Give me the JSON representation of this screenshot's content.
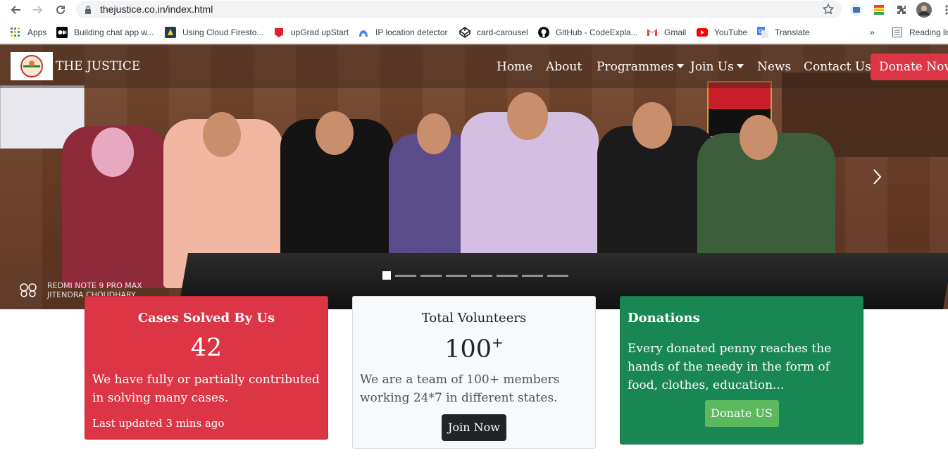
{
  "browser": {
    "url": "thejustice.co.in/index.html",
    "bookmarks": [
      {
        "label": "Apps",
        "icon": "apps-grid-icon"
      },
      {
        "label": "Building chat app w...",
        "icon": "medium-icon"
      },
      {
        "label": "Using Cloud Firesto...",
        "icon": "firestore-icon"
      },
      {
        "label": "upGrad upStart",
        "icon": "upgrad-icon"
      },
      {
        "label": "IP location detector",
        "icon": "ip-icon"
      },
      {
        "label": "card-carousel",
        "icon": "codepen-icon"
      },
      {
        "label": "GitHub - CodeExpla...",
        "icon": "github-icon"
      },
      {
        "label": "Gmail",
        "icon": "gmail-icon"
      },
      {
        "label": "YouTube",
        "icon": "youtube-icon"
      },
      {
        "label": "Translate",
        "icon": "translate-icon"
      }
    ],
    "overflow": "»",
    "reading_list": "Reading lis"
  },
  "site": {
    "brand": "THE JUSTICE",
    "nav": {
      "home": "Home",
      "about": "About",
      "programmes": "Programmes",
      "join_us": "Join Us",
      "news": "News",
      "contact": "Contact Us",
      "donate": "Donate Now.."
    },
    "carousel": {
      "watermark_line1": "REDMI NOTE 9 PRO MAX",
      "watermark_line2": "JITENDRA CHOUDHARY",
      "slide_count": 8,
      "active_slide": 1
    }
  },
  "cards": {
    "cases": {
      "title": "Cases Solved By Us",
      "number": "42",
      "text": "We have fully or partially contributed in solving many cases.",
      "updated": "Last updated 3 mins ago"
    },
    "volunteers": {
      "title": "Total Volunteers",
      "number": "100",
      "plus": "+",
      "text": "We are a team of 100+ members working 24*7 in different states.",
      "button": "Join Now"
    },
    "donations": {
      "title": "Donations",
      "text": "Every donated penny reaches the hands of the needy in the form of food, clothes, education...",
      "button": "Donate US"
    }
  },
  "colors": {
    "danger": "#dc3545",
    "success": "#198754",
    "light": "#f8f9fa",
    "dark": "#212529"
  }
}
